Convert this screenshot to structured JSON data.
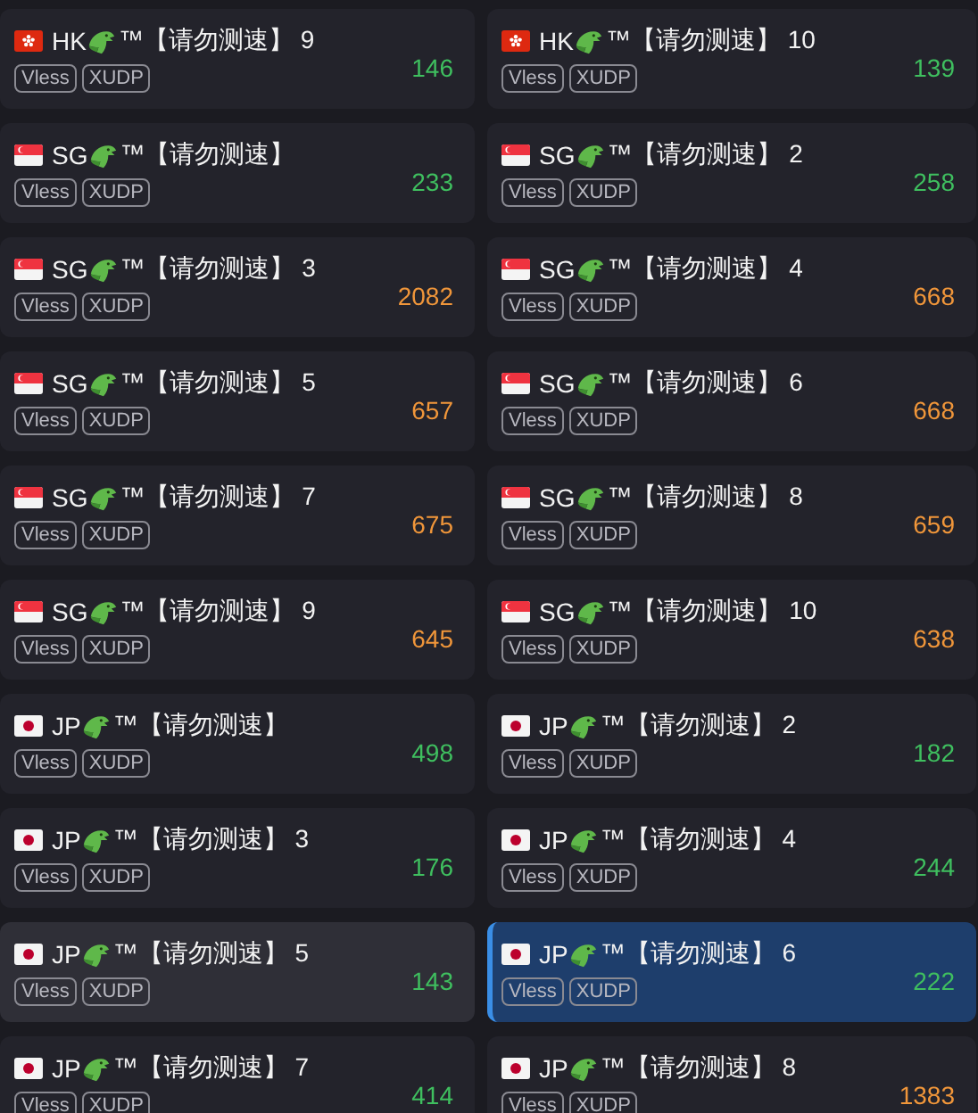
{
  "nodes": [
    {
      "kind": "hk",
      "region": "HK",
      "suffix": "™【请勿测速】 9",
      "tags": [
        "Vless",
        "XUDP"
      ],
      "latency": "146",
      "color": "#3fbf5f",
      "hovered": false,
      "selected": false
    },
    {
      "kind": "hk",
      "region": "HK",
      "suffix": "™【请勿测速】 10",
      "tags": [
        "Vless",
        "XUDP"
      ],
      "latency": "139",
      "color": "#3fbf5f",
      "hovered": false,
      "selected": false
    },
    {
      "kind": "sg",
      "region": "SG",
      "suffix": "™【请勿测速】",
      "tags": [
        "Vless",
        "XUDP"
      ],
      "latency": "233",
      "color": "#3fbf5f",
      "hovered": false,
      "selected": false
    },
    {
      "kind": "sg",
      "region": "SG",
      "suffix": "™【请勿测速】 2",
      "tags": [
        "Vless",
        "XUDP"
      ],
      "latency": "258",
      "color": "#3fbf5f",
      "hovered": false,
      "selected": false
    },
    {
      "kind": "sg",
      "region": "SG",
      "suffix": "™【请勿测速】 3",
      "tags": [
        "Vless",
        "XUDP"
      ],
      "latency": "2082",
      "color": "#f0963a",
      "hovered": false,
      "selected": false
    },
    {
      "kind": "sg",
      "region": "SG",
      "suffix": "™【请勿测速】 4",
      "tags": [
        "Vless",
        "XUDP"
      ],
      "latency": "668",
      "color": "#f0963a",
      "hovered": false,
      "selected": false
    },
    {
      "kind": "sg",
      "region": "SG",
      "suffix": "™【请勿测速】 5",
      "tags": [
        "Vless",
        "XUDP"
      ],
      "latency": "657",
      "color": "#f0963a",
      "hovered": false,
      "selected": false
    },
    {
      "kind": "sg",
      "region": "SG",
      "suffix": "™【请勿测速】 6",
      "tags": [
        "Vless",
        "XUDP"
      ],
      "latency": "668",
      "color": "#f0963a",
      "hovered": false,
      "selected": false
    },
    {
      "kind": "sg",
      "region": "SG",
      "suffix": "™【请勿测速】 7",
      "tags": [
        "Vless",
        "XUDP"
      ],
      "latency": "675",
      "color": "#f0963a",
      "hovered": false,
      "selected": false
    },
    {
      "kind": "sg",
      "region": "SG",
      "suffix": "™【请勿测速】 8",
      "tags": [
        "Vless",
        "XUDP"
      ],
      "latency": "659",
      "color": "#f0963a",
      "hovered": false,
      "selected": false
    },
    {
      "kind": "sg",
      "region": "SG",
      "suffix": "™【请勿测速】 9",
      "tags": [
        "Vless",
        "XUDP"
      ],
      "latency": "645",
      "color": "#f0963a",
      "hovered": false,
      "selected": false
    },
    {
      "kind": "sg",
      "region": "SG",
      "suffix": "™【请勿测速】 10",
      "tags": [
        "Vless",
        "XUDP"
      ],
      "latency": "638",
      "color": "#f0963a",
      "hovered": false,
      "selected": false
    },
    {
      "kind": "jp",
      "region": "JP",
      "suffix": "™【请勿测速】",
      "tags": [
        "Vless",
        "XUDP"
      ],
      "latency": "498",
      "color": "#3fbf5f",
      "hovered": false,
      "selected": false
    },
    {
      "kind": "jp",
      "region": "JP",
      "suffix": "™【请勿测速】 2",
      "tags": [
        "Vless",
        "XUDP"
      ],
      "latency": "182",
      "color": "#3fbf5f",
      "hovered": false,
      "selected": false
    },
    {
      "kind": "jp",
      "region": "JP",
      "suffix": "™【请勿测速】 3",
      "tags": [
        "Vless",
        "XUDP"
      ],
      "latency": "176",
      "color": "#3fbf5f",
      "hovered": false,
      "selected": false
    },
    {
      "kind": "jp",
      "region": "JP",
      "suffix": "™【请勿测速】 4",
      "tags": [
        "Vless",
        "XUDP"
      ],
      "latency": "244",
      "color": "#3fbf5f",
      "hovered": false,
      "selected": false
    },
    {
      "kind": "jp",
      "region": "JP",
      "suffix": "™【请勿测速】 5",
      "tags": [
        "Vless",
        "XUDP"
      ],
      "latency": "143",
      "color": "#3fbf5f",
      "hovered": true,
      "selected": false
    },
    {
      "kind": "jp",
      "region": "JP",
      "suffix": "™【请勿测速】 6",
      "tags": [
        "Vless",
        "XUDP"
      ],
      "latency": "222",
      "color": "#3fbf5f",
      "hovered": false,
      "selected": true
    },
    {
      "kind": "jp",
      "region": "JP",
      "suffix": "™【请勿测速】 7",
      "tags": [
        "Vless",
        "XUDP"
      ],
      "latency": "414",
      "color": "#3fbf5f",
      "hovered": false,
      "selected": false
    },
    {
      "kind": "jp",
      "region": "JP",
      "suffix": "™【请勿测速】 8",
      "tags": [
        "Vless",
        "XUDP"
      ],
      "latency": "1383",
      "color": "#f0963a",
      "hovered": false,
      "selected": false
    }
  ]
}
